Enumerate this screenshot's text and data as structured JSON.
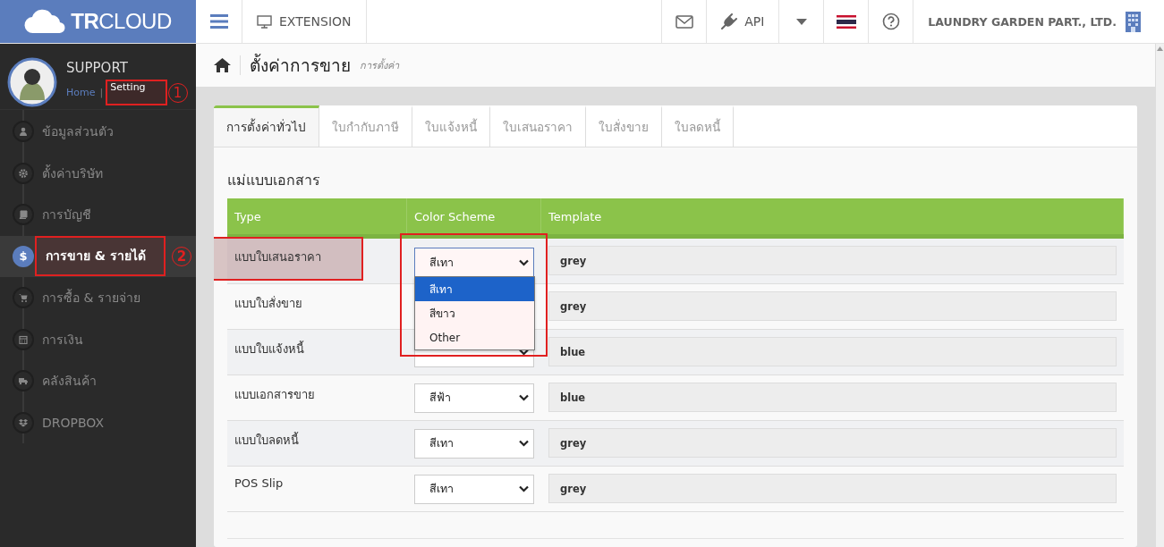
{
  "brand": {
    "logo": "**TR**CLOUD"
  },
  "topbar": {
    "extension": "EXTENSION",
    "api": "API",
    "company": "LAUNDRY GARDEN PART., LTD."
  },
  "profile": {
    "name": "SUPPORT",
    "breadcrumb_separator": "|",
    "breadcrumb": [
      {
        "label": "Home",
        "current": false
      },
      {
        "label": "Setting",
        "current": true,
        "callout": "1"
      }
    ]
  },
  "sidebar": {
    "items": [
      {
        "label": "ข้อมูลส่วนตัว",
        "kind": "user",
        "selected": false
      },
      {
        "label": "ตั้งค่าบริษัท",
        "kind": "gear",
        "selected": false
      },
      {
        "label": "การบัญชี",
        "kind": "book",
        "selected": false
      },
      {
        "label": "การขาย & รายได้",
        "kind": "glyph",
        "glyph": "$",
        "selected": true,
        "callout": "2"
      },
      {
        "label": "การซื้อ & รายจ่าย",
        "kind": "cart",
        "selected": false
      },
      {
        "label": "การเงิน",
        "kind": "calendar",
        "selected": false
      },
      {
        "label": "คลังสินค้า",
        "kind": "truck",
        "selected": false
      },
      {
        "label": "DROPBOX",
        "kind": "dropbox",
        "selected": false
      }
    ]
  },
  "page": {
    "title": "ตั้งค่าการขาย",
    "subtitle": "การตั้งค่า"
  },
  "tabs": [
    {
      "label": "การตั้งค่าทั่วไป",
      "selected": true
    },
    {
      "label": "ใบกำกับภาษี",
      "selected": false
    },
    {
      "label": "ใบแจ้งหนี้",
      "selected": false
    },
    {
      "label": "ใบเสนอราคา",
      "selected": false
    },
    {
      "label": "ใบสั่งขาย",
      "selected": false
    },
    {
      "label": "ใบลดหนี้",
      "selected": false
    }
  ],
  "section_title": "แม่แบบเอกสาร",
  "table": {
    "columns": [
      "Type",
      "Color Scheme",
      "Template"
    ],
    "rows": [
      {
        "type": "แบบใบเสนอราคา",
        "color_scheme": "สีเทา",
        "template": "grey",
        "highlighted": true,
        "open": true
      },
      {
        "type": "แบบใบสั่งขาย",
        "template": "grey",
        "highlighted": false,
        "open": false
      },
      {
        "type": "แบบใบแจ้งหนี้",
        "template": "blue",
        "highlighted": false,
        "open": false
      },
      {
        "type": "แบบเอกสารขาย",
        "color_scheme": "สีฟ้า",
        "template": "blue",
        "highlighted": false,
        "open": false
      },
      {
        "type": "แบบใบลดหนี้",
        "color_scheme": "สีเทา",
        "template": "grey",
        "highlighted": false,
        "open": false
      },
      {
        "type": "POS Slip",
        "color_scheme": "สีเทา",
        "template": "grey",
        "highlighted": false,
        "open": false
      }
    ]
  },
  "dropdown_options": [
    {
      "label": "สีเทา",
      "selected": true
    },
    {
      "label": "สีขาว",
      "selected": false
    },
    {
      "label": "Other",
      "selected": false
    }
  ]
}
